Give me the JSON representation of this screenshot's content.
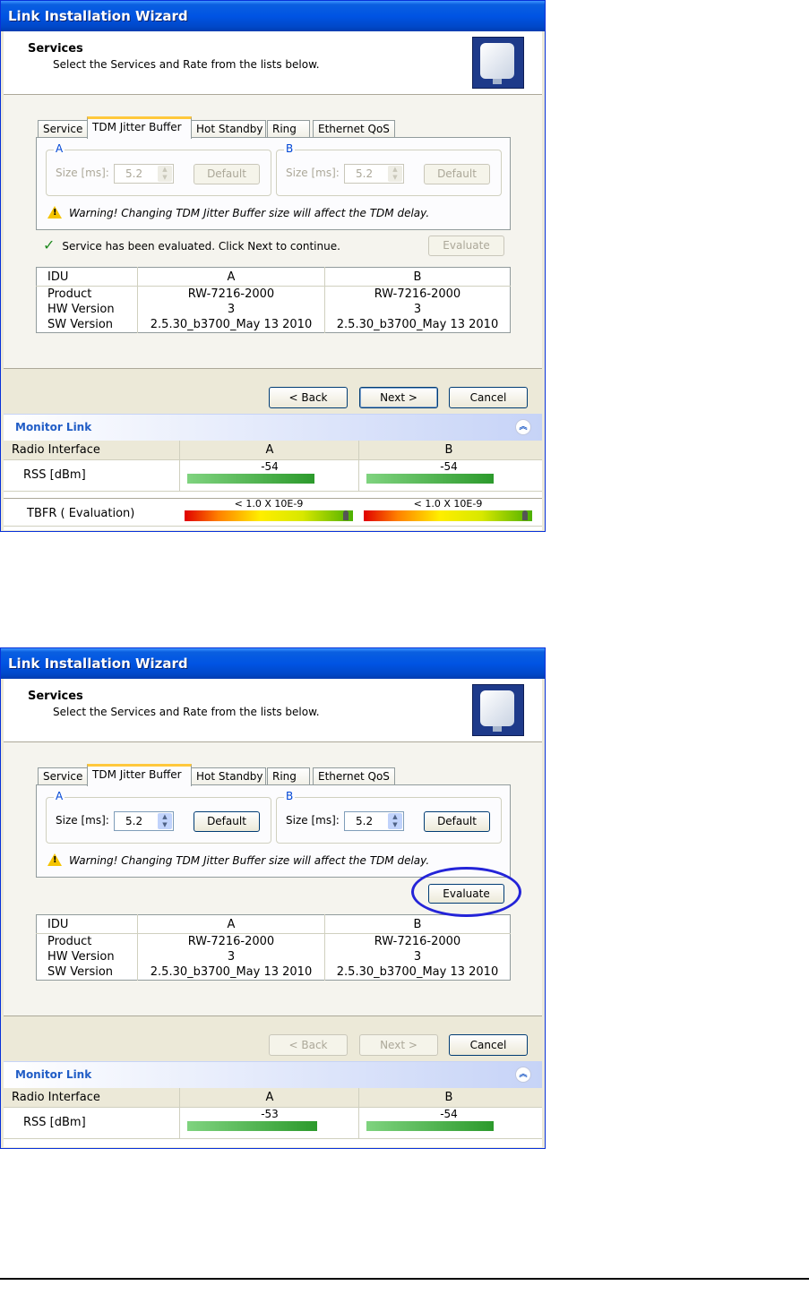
{
  "screens": [
    {
      "window_title": "Link Installation Wizard",
      "header_title": "Services",
      "header_subtitle": "Select the Services and Rate from the lists below.",
      "tabs": [
        "Service",
        "TDM Jitter Buffer",
        "Hot Standby",
        "Ring",
        "Ethernet QoS"
      ],
      "active_tab": "TDM Jitter Buffer",
      "group_a": {
        "label": "A",
        "size_label": "Size [ms]:",
        "size_value": "5.2",
        "default_label": "Default"
      },
      "group_b": {
        "label": "B",
        "size_label": "Size [ms]:",
        "size_value": "5.2",
        "default_label": "Default"
      },
      "warning": "Warning! Changing TDM Jitter Buffer size will affect the TDM delay.",
      "status": "Service has been evaluated. Click Next to continue.",
      "evaluate_label": "Evaluate",
      "table": {
        "headers": [
          "IDU",
          "A",
          "B"
        ],
        "rows": [
          [
            "Product",
            "RW-7216-2000",
            "RW-7216-2000"
          ],
          [
            "HW Version",
            "3",
            "3"
          ],
          [
            "SW Version",
            "2.5.30_b3700_May 13 2010",
            "2.5.30_b3700_May 13 2010"
          ]
        ]
      },
      "back_label": "< Back",
      "next_label": "Next >",
      "cancel_label": "Cancel",
      "monitor_title": "Monitor Link",
      "monitor": {
        "headers": [
          "Radio Interface",
          "A",
          "B"
        ],
        "rss_label": "RSS [dBm]",
        "rss_a": "-54",
        "rss_b": "-54",
        "tbfr_label": "TBFR ( Evaluation)",
        "tbfr_a": "< 1.0 X 10E-9",
        "tbfr_b": "< 1.0 X 10E-9"
      },
      "state": {
        "fields_enabled": false,
        "evaluate_enabled": false,
        "nav_enabled": true
      }
    },
    {
      "window_title": "Link Installation Wizard",
      "header_title": "Services",
      "header_subtitle": "Select the Services and Rate from the lists below.",
      "tabs": [
        "Service",
        "TDM Jitter Buffer",
        "Hot Standby",
        "Ring",
        "Ethernet QoS"
      ],
      "active_tab": "TDM Jitter Buffer",
      "group_a": {
        "label": "A",
        "size_label": "Size [ms]:",
        "size_value": "5.2",
        "default_label": "Default"
      },
      "group_b": {
        "label": "B",
        "size_label": "Size [ms]:",
        "size_value": "5.2",
        "default_label": "Default"
      },
      "warning": "Warning! Changing TDM Jitter Buffer size will affect the TDM delay.",
      "evaluate_label": "Evaluate",
      "table": {
        "headers": [
          "IDU",
          "A",
          "B"
        ],
        "rows": [
          [
            "Product",
            "RW-7216-2000",
            "RW-7216-2000"
          ],
          [
            "HW Version",
            "3",
            "3"
          ],
          [
            "SW Version",
            "2.5.30_b3700_May 13 2010",
            "2.5.30_b3700_May 13 2010"
          ]
        ]
      },
      "back_label": "< Back",
      "next_label": "Next >",
      "cancel_label": "Cancel",
      "monitor_title": "Monitor Link",
      "monitor": {
        "headers": [
          "Radio Interface",
          "A",
          "B"
        ],
        "rss_label": "RSS [dBm]",
        "rss_a": "-53",
        "rss_b": "-54"
      },
      "state": {
        "fields_enabled": true,
        "evaluate_enabled": true,
        "nav_enabled": false
      }
    }
  ],
  "colors": {
    "titlebar": "#0054e3",
    "highlight": "#2424d8",
    "tab_accent": "#ffc83c",
    "rss_bar": "#2c9a2c"
  }
}
